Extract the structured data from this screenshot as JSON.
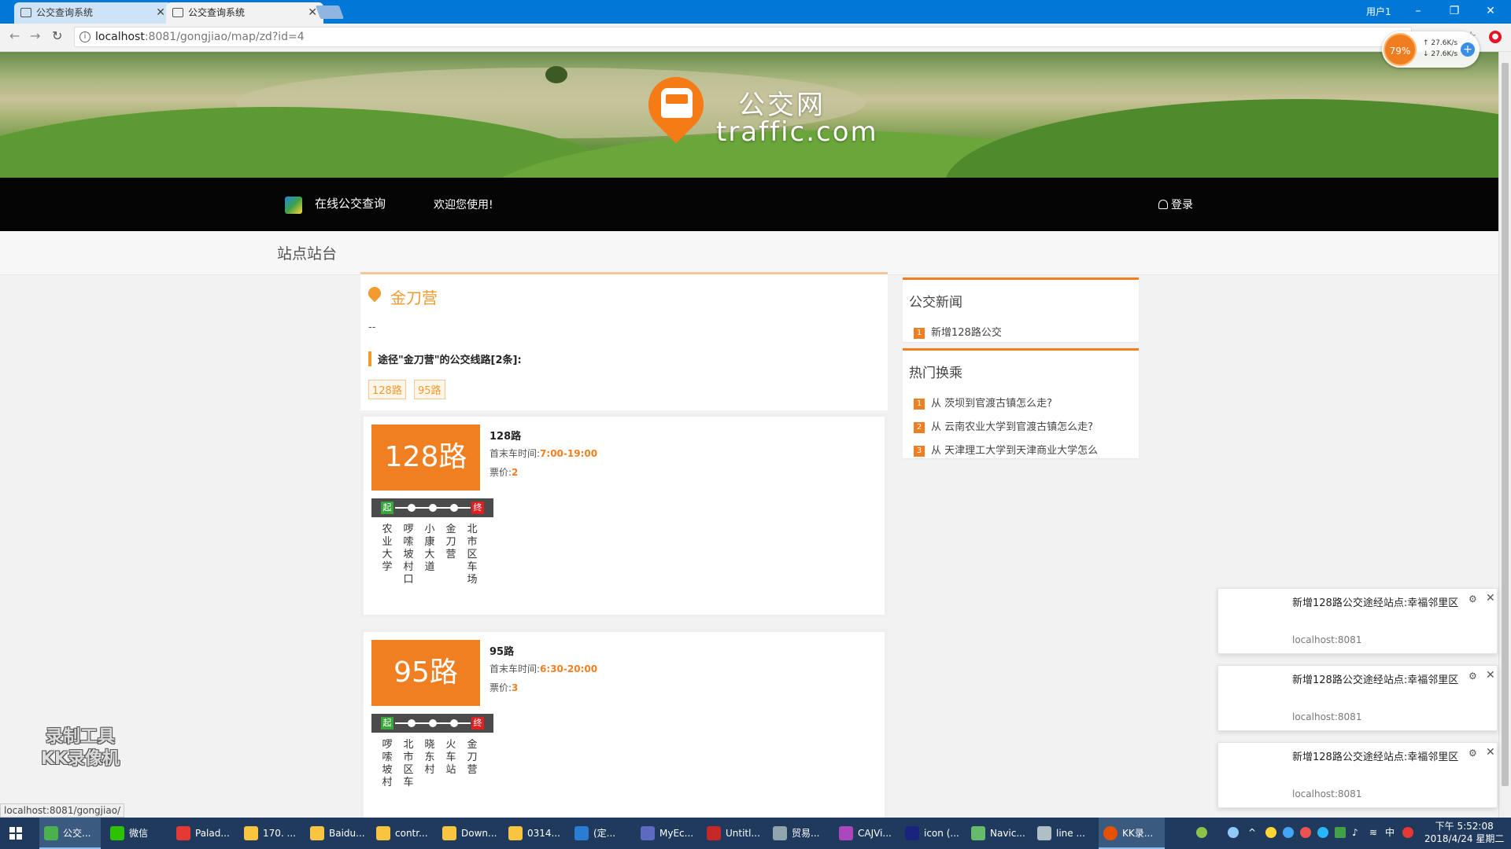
{
  "browser": {
    "tabs": [
      {
        "title": "公交查询系统",
        "active": false
      },
      {
        "title": "公交查询系统",
        "active": true
      }
    ],
    "window_user": "用户1",
    "url_host": "localhost",
    "url_rest": ":8081/gongjiao/map/zd?id=4",
    "speed_percent": "79%",
    "speed_up": "27.6K/s",
    "speed_down": "27.6K/s"
  },
  "header": {
    "logo_cn": "公交网",
    "logo_en": "traffic.com"
  },
  "nav": {
    "items": [
      "在线公交查询",
      "欢迎您使用!"
    ],
    "login": "登录"
  },
  "section": {
    "title": "站点站台"
  },
  "station": {
    "name": "金刀营",
    "description": "--",
    "routes_heading": "途径\"金刀营\"的公交线路[2条]:",
    "route_tags": [
      "128路",
      "95路"
    ]
  },
  "routes": [
    {
      "badge": "128路",
      "name": "128路",
      "time_label": "首末车时间:",
      "time": "7:00-19:00",
      "price_label": "票价:",
      "price": "2",
      "start_label": "起",
      "end_label": "终",
      "stops": [
        "农业大学",
        "啰嗦坡村口",
        "小康大道",
        "金刀营",
        "北市区车场"
      ]
    },
    {
      "badge": "95路",
      "name": "95路",
      "time_label": "首末车时间:",
      "time": "6:30-20:00",
      "price_label": "票价:",
      "price": "3",
      "start_label": "起",
      "end_label": "终",
      "stops": [
        "啰嗦坡村",
        "北市区车",
        "晓东村",
        "火车站",
        "金刀营"
      ]
    }
  ],
  "sidebar": {
    "news": {
      "title": "公交新闻",
      "items": [
        {
          "num": "1",
          "text": "新增128路公交"
        }
      ]
    },
    "hot_transfer": {
      "title": "热门换乘",
      "items": [
        {
          "num": "1",
          "text": "从 茨坝到官渡古镇怎么走?"
        },
        {
          "num": "2",
          "text": "从 云南农业大学到官渡古镇怎么走?"
        },
        {
          "num": "3",
          "text": "从 天津理工大学到天津商业大学怎么"
        }
      ]
    }
  },
  "notifications": [
    {
      "text": "新增128路公交途经站点:幸福邻里区",
      "source": "localhost:8081"
    },
    {
      "text": "新增128路公交途经站点:幸福邻里区",
      "source": "localhost:8081"
    },
    {
      "text": "新增128路公交途经站点:幸福邻里区",
      "source": "localhost:8081"
    }
  ],
  "watermark": {
    "line1": "录制工具",
    "line2": "KK录像机"
  },
  "status_bar": "localhost:8081/gongjiao/",
  "taskbar": {
    "items": [
      "公交...",
      "微信",
      "Palad...",
      "170. ...",
      "Baidu...",
      "contr...",
      "Down...",
      "0314...",
      "(定...",
      "MyEc...",
      "Untitl...",
      "贸易...",
      "CAJVi...",
      "icon (...",
      "Navic...",
      "line ...",
      "KK录..."
    ],
    "clock_time": "下午 5:52:08",
    "clock_date": "2018/4/24 星期二",
    "ime": "中"
  },
  "colors": {
    "accent": "#f07f22",
    "titlebar": "#0078d7",
    "navbar": "#050505",
    "start": "#3aa53c",
    "end": "#e02020"
  }
}
